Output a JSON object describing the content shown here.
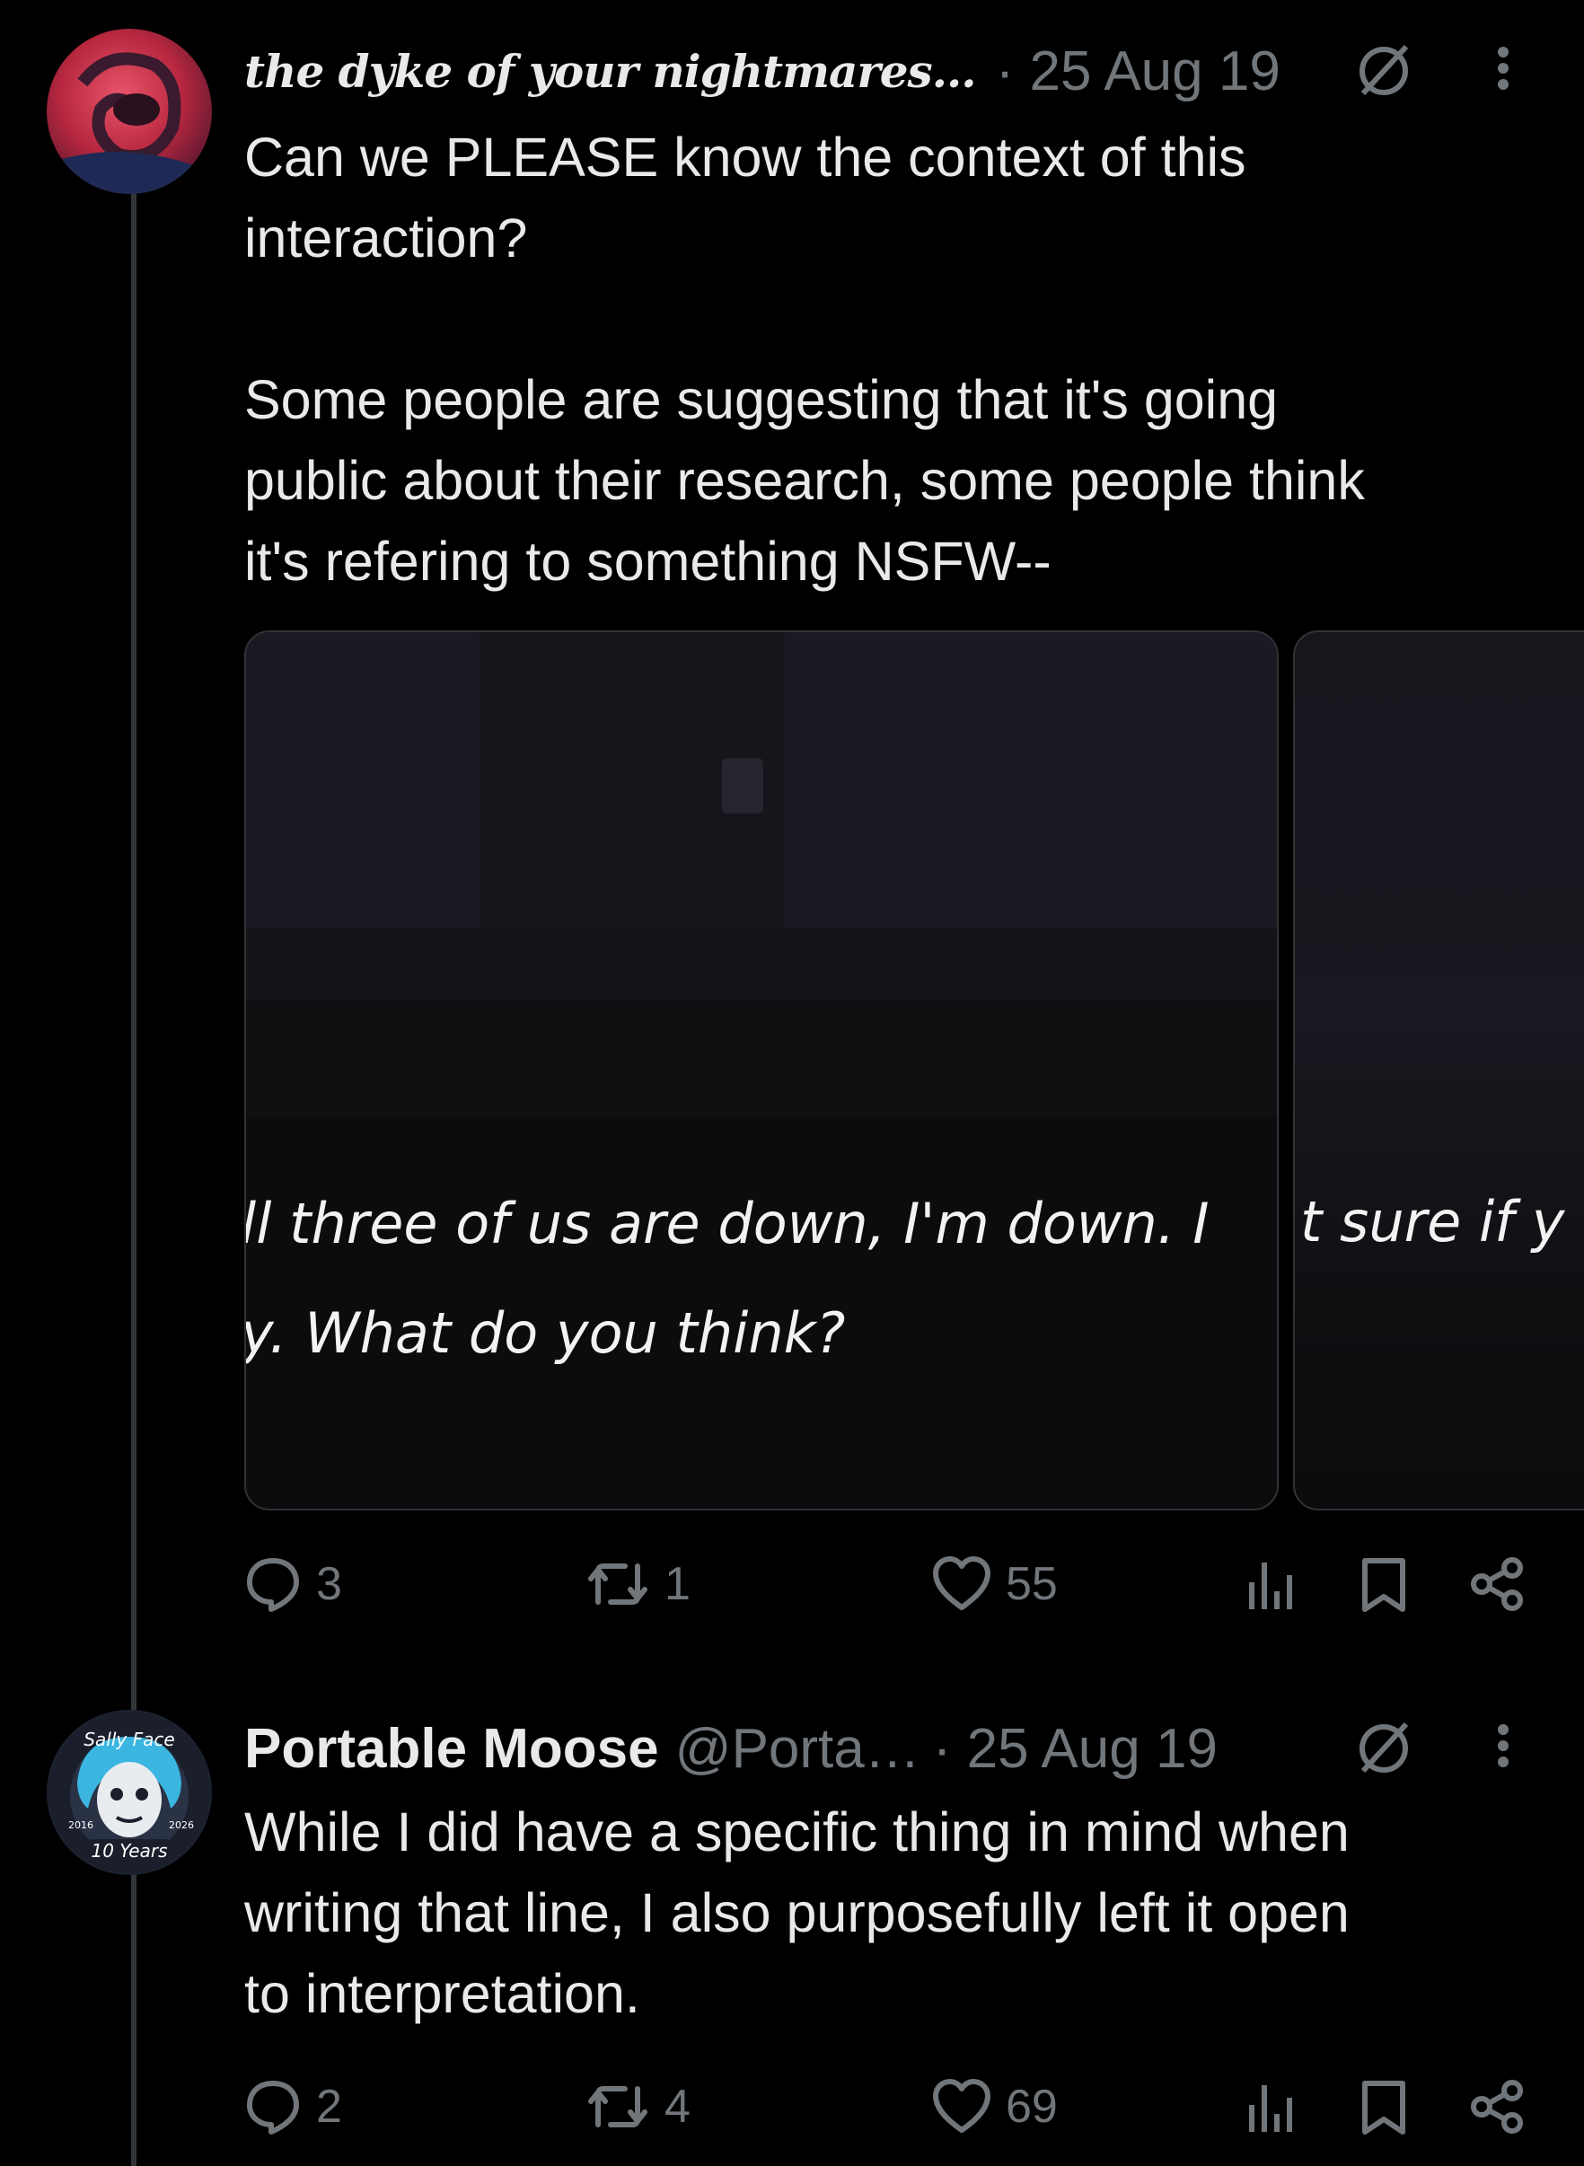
{
  "tweets": [
    {
      "display_name": "the dyke of your nightmares…",
      "date": "· 25 Aug 19",
      "text": "Can we PLEASE know the context of this\ninteraction?\n\nSome people are suggesting that it's going\npublic about their research, some people think\nit's refering to something NSFW--",
      "media": {
        "caption_line1": "ll three of us are down, I'm down. I",
        "caption_line2": "y. What do you think?",
        "caption_partial": "t sure if y"
      },
      "actions": {
        "replies": "3",
        "reposts": "1",
        "likes": "55"
      }
    },
    {
      "display_name": "Portable Moose",
      "handle": "@Porta…",
      "date": "· 25 Aug 19",
      "avatar_badge": {
        "top": "Sally Face",
        "left_year": "2016",
        "right_year": "2026",
        "bottom": "10 Years"
      },
      "text": "While I did have a specific thing in mind when\nwriting that line, I also purposefully left it open\nto interpretation.",
      "actions": {
        "replies": "2",
        "reposts": "4",
        "likes": "69"
      }
    }
  ],
  "icons": {
    "grok": "grok-icon",
    "more": "more-icon",
    "reply": "reply-icon",
    "repost": "repost-icon",
    "like": "like-icon",
    "views": "views-icon",
    "bookmark": "bookmark-icon",
    "share": "share-icon"
  },
  "colors": {
    "background": "#000000",
    "text": "#e7e9ea",
    "muted": "#71767b",
    "thread_line": "#333639"
  }
}
